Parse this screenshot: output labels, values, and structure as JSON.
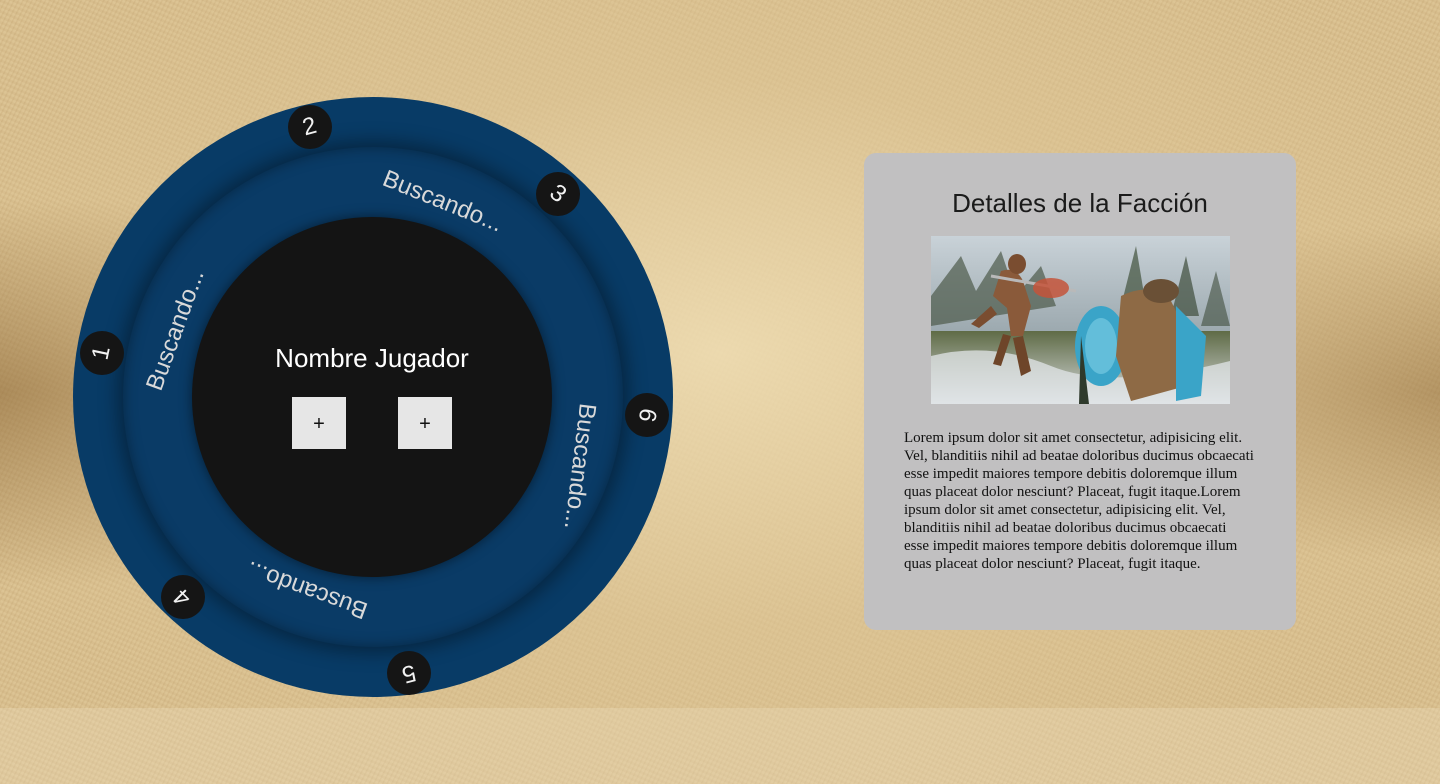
{
  "wheel": {
    "player_name": "Nombre Jugador",
    "add_button_1": "+",
    "add_button_2": "+",
    "slots": [
      {
        "number": "1"
      },
      {
        "number": "2"
      },
      {
        "number": "3"
      },
      {
        "number": "4"
      },
      {
        "number": "5"
      },
      {
        "number": "6"
      }
    ],
    "searching": [
      {
        "label": "Buscando..."
      },
      {
        "label": "Buscando..."
      },
      {
        "label": "Buscando..."
      },
      {
        "label": "Buscando..."
      }
    ]
  },
  "details": {
    "title": "Detalles de la Facción",
    "image_icon": "battle-scene-image",
    "description": "Lorem ipsum dolor sit amet consectetur, adipisicing elit. Vel, blanditiis nihil ad beatae doloribus ducimus obcaecati esse impedit maiores tempore debitis doloremque illum quas placeat dolor nesciunt? Placeat, fugit itaque.Lorem ipsum dolor sit amet consectetur, adipisicing elit. Vel, blanditiis nihil ad beatae doloribus ducimus obcaecati esse impedit maiores tempore debitis doloremque illum quas placeat dolor nesciunt? Placeat, fugit itaque."
  },
  "colors": {
    "wheel_ring": "#083b66",
    "wheel_core": "#141414",
    "panel_bg": "#c1c0c1"
  }
}
